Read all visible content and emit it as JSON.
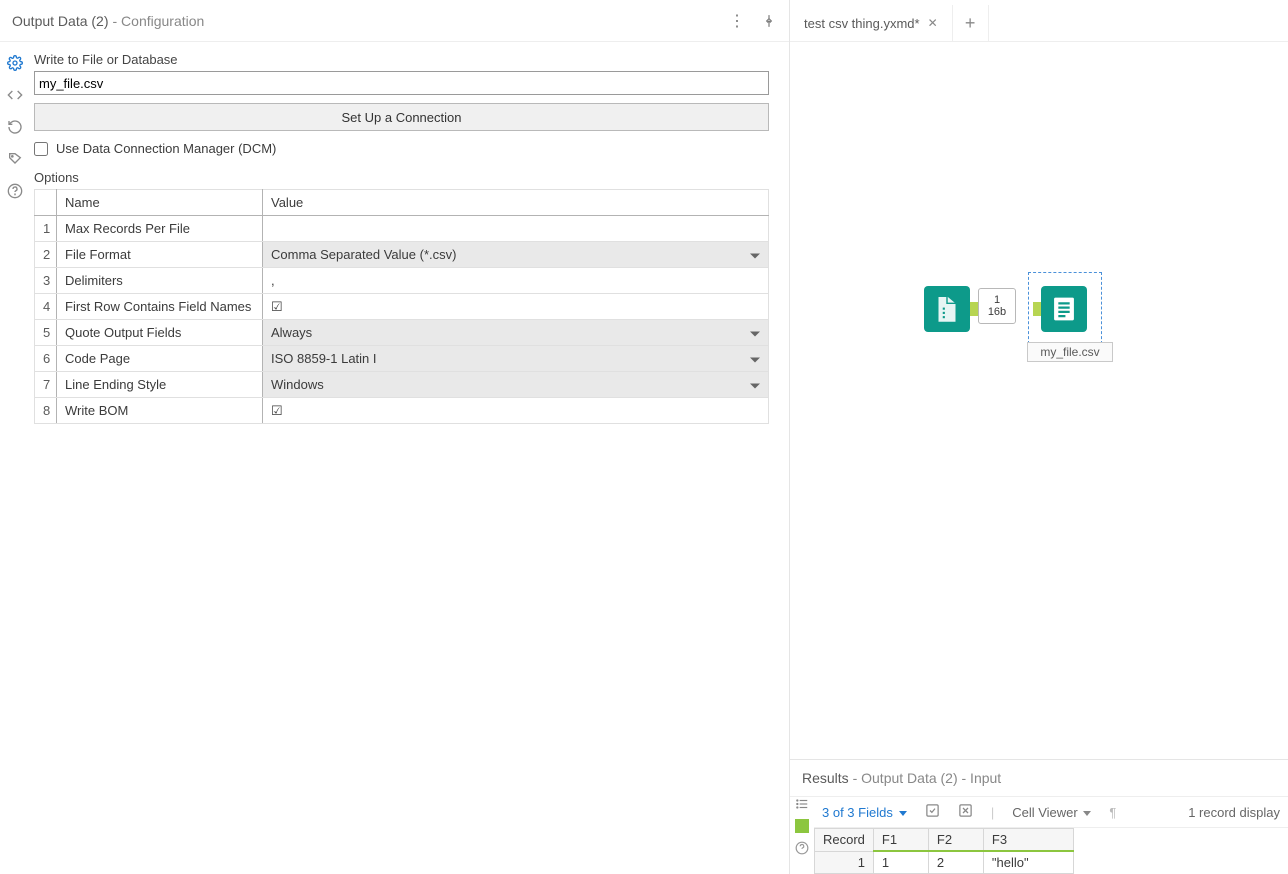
{
  "config": {
    "title_main": "Output Data (2)",
    "title_sub": "- Configuration",
    "write_label": "Write to File or Database",
    "file_value": "my_file.csv",
    "connection_btn": "Set Up a Connection",
    "dcm_label": "Use Data Connection Manager (DCM)",
    "options_label": "Options",
    "columns": {
      "name": "Name",
      "value": "Value"
    },
    "rows": [
      {
        "n": "1",
        "name": "Max Records Per File",
        "type": "text",
        "value": ""
      },
      {
        "n": "2",
        "name": "File Format",
        "type": "select",
        "value": "Comma Separated Value (*.csv)"
      },
      {
        "n": "3",
        "name": "Delimiters",
        "type": "text",
        "value": ","
      },
      {
        "n": "4",
        "name": "First Row Contains Field Names",
        "type": "check",
        "value": "☑"
      },
      {
        "n": "5",
        "name": "Quote Output Fields",
        "type": "select",
        "value": "Always"
      },
      {
        "n": "6",
        "name": "Code Page",
        "type": "select",
        "value": "ISO 8859-1 Latin I"
      },
      {
        "n": "7",
        "name": "Line Ending Style",
        "type": "select",
        "value": "Windows"
      },
      {
        "n": "8",
        "name": "Write BOM",
        "type": "check",
        "value": "☑"
      }
    ]
  },
  "tabs": {
    "active": "test csv thing.yxmd*"
  },
  "canvas": {
    "conn_top": "1",
    "conn_bottom": "16b",
    "output_label": "my_file.csv"
  },
  "results": {
    "header_prefix": "Results",
    "header_rest": "- Output Data (2) - Input",
    "fields_link": "3 of 3 Fields",
    "cell_viewer": "Cell Viewer",
    "record_count": "1 record display",
    "headers": [
      "Record",
      "F1",
      "F2",
      "F3"
    ],
    "row": {
      "rec": "1",
      "f1": "1",
      "f2": "2",
      "f3": "\"hello\""
    }
  }
}
